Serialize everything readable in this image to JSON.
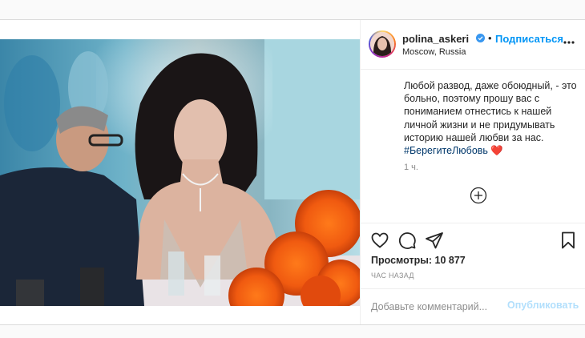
{
  "post": {
    "username": "polina_askeri",
    "separator": "•",
    "follow_label": "Подписаться",
    "location": "Moscow, Russia",
    "caption": "Любой развод, даже обоюдный, - это больно, поэтому прошу вас с пониманием отнестись к нашей личной жизни и не придумывать историю нашей любви за нас.",
    "hashtag": "#БерегитеЛюбовь",
    "heart_emoji": "❤️",
    "time": "1 ч.",
    "views_label": "Просмотры:",
    "views_count": "10 877",
    "ago": "ЧАС НАЗАД"
  },
  "comment": {
    "placeholder": "Добавьте комментарий...",
    "publish_label": "Опубликовать"
  },
  "icons": {
    "verified": "verified-badge-icon",
    "more": "more-options-icon",
    "add": "add-comment-circle-icon",
    "like": "heart-outline-icon",
    "comment": "comment-bubble-icon",
    "share": "paper-plane-icon",
    "save": "bookmark-icon"
  },
  "colors": {
    "link_blue": "#0095f6",
    "publish_disabled": "#b2dffc",
    "hashtag": "#00376b",
    "muted": "#8e8e8e"
  }
}
